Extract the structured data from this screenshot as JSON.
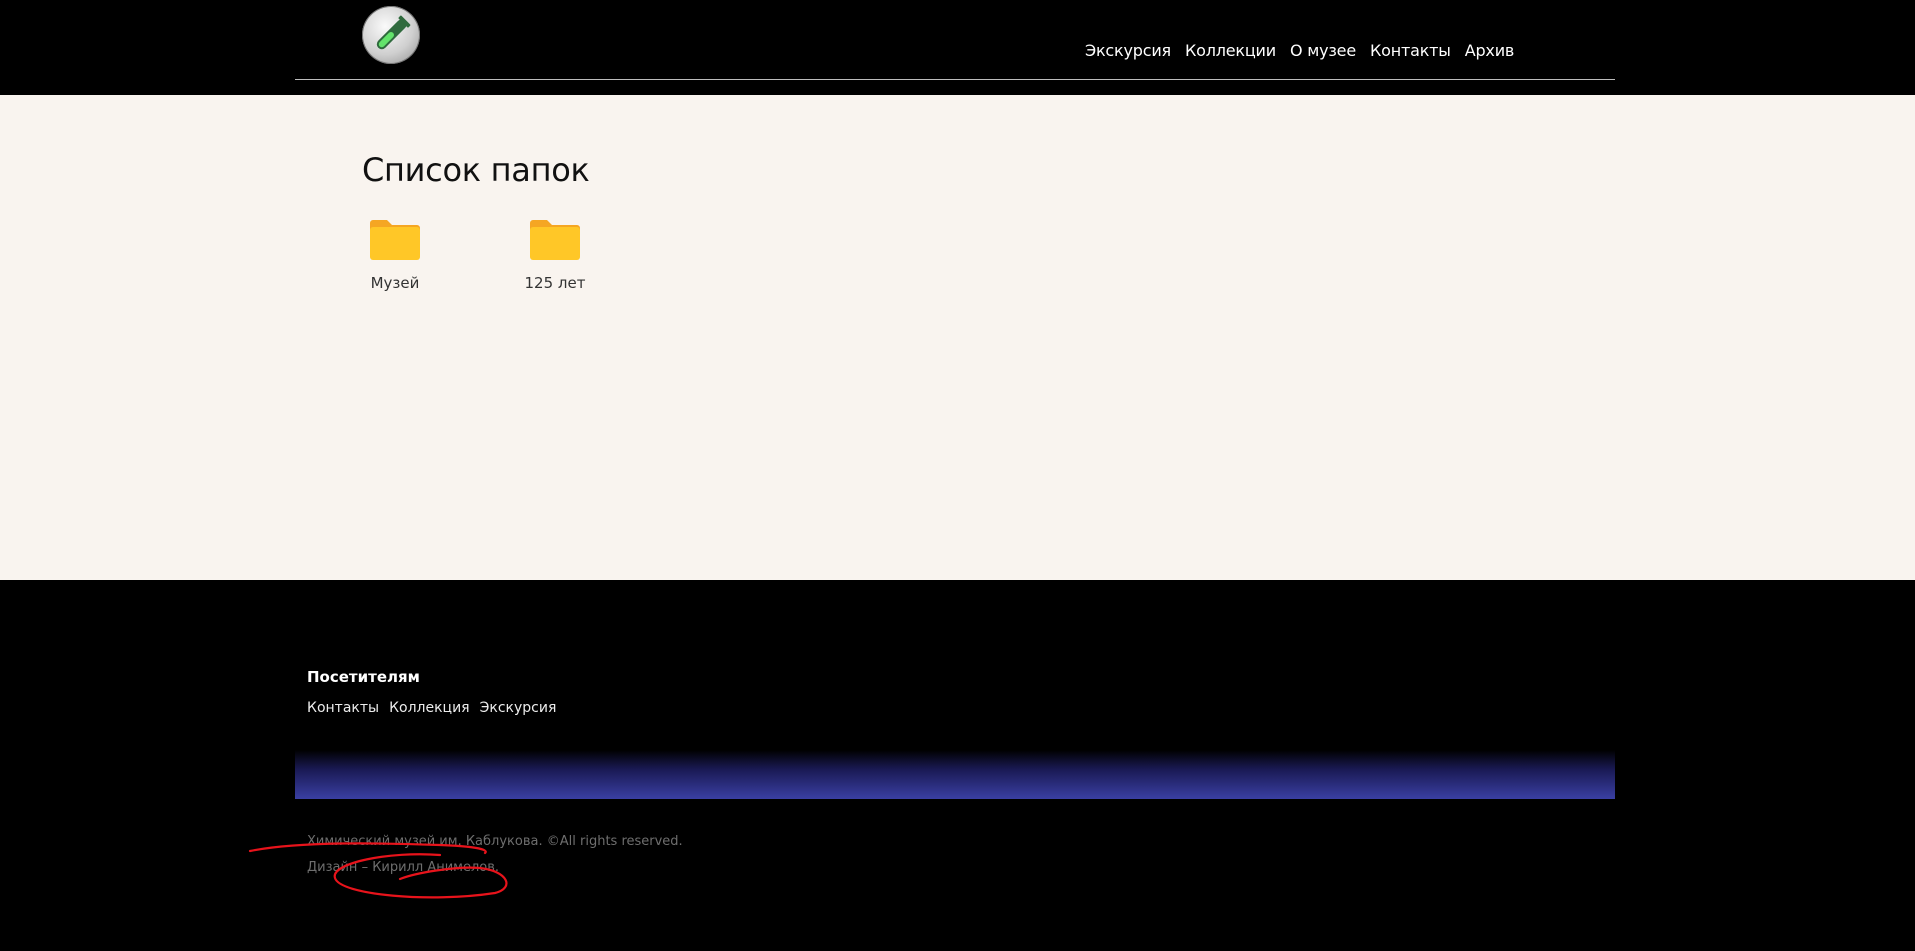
{
  "header": {
    "logo_icon": "test-tube-icon",
    "nav": [
      {
        "label": "Экскурсия"
      },
      {
        "label": "Коллекции"
      },
      {
        "label": "О музее"
      },
      {
        "label": "Контакты"
      },
      {
        "label": "Архив"
      }
    ]
  },
  "main": {
    "title": "Список папок",
    "folders": [
      {
        "label": "Музей",
        "icon": "folder-icon"
      },
      {
        "label": "125 лет",
        "icon": "folder-icon"
      }
    ]
  },
  "footer": {
    "heading": "Посетителям",
    "links": [
      {
        "label": "Контакты"
      },
      {
        "label": "Коллекция"
      },
      {
        "label": "Экскурсия"
      }
    ],
    "copyright": "Химический музей им. Каблукова. ©All rights reserved.",
    "design": "Дизайн – Кирилл Анимелов."
  },
  "colors": {
    "header_bg": "#000000",
    "main_bg": "#f9f4ef",
    "folder": "#ffc727",
    "band_accent": "#3a3fa3",
    "annotation": "#e8131b"
  }
}
